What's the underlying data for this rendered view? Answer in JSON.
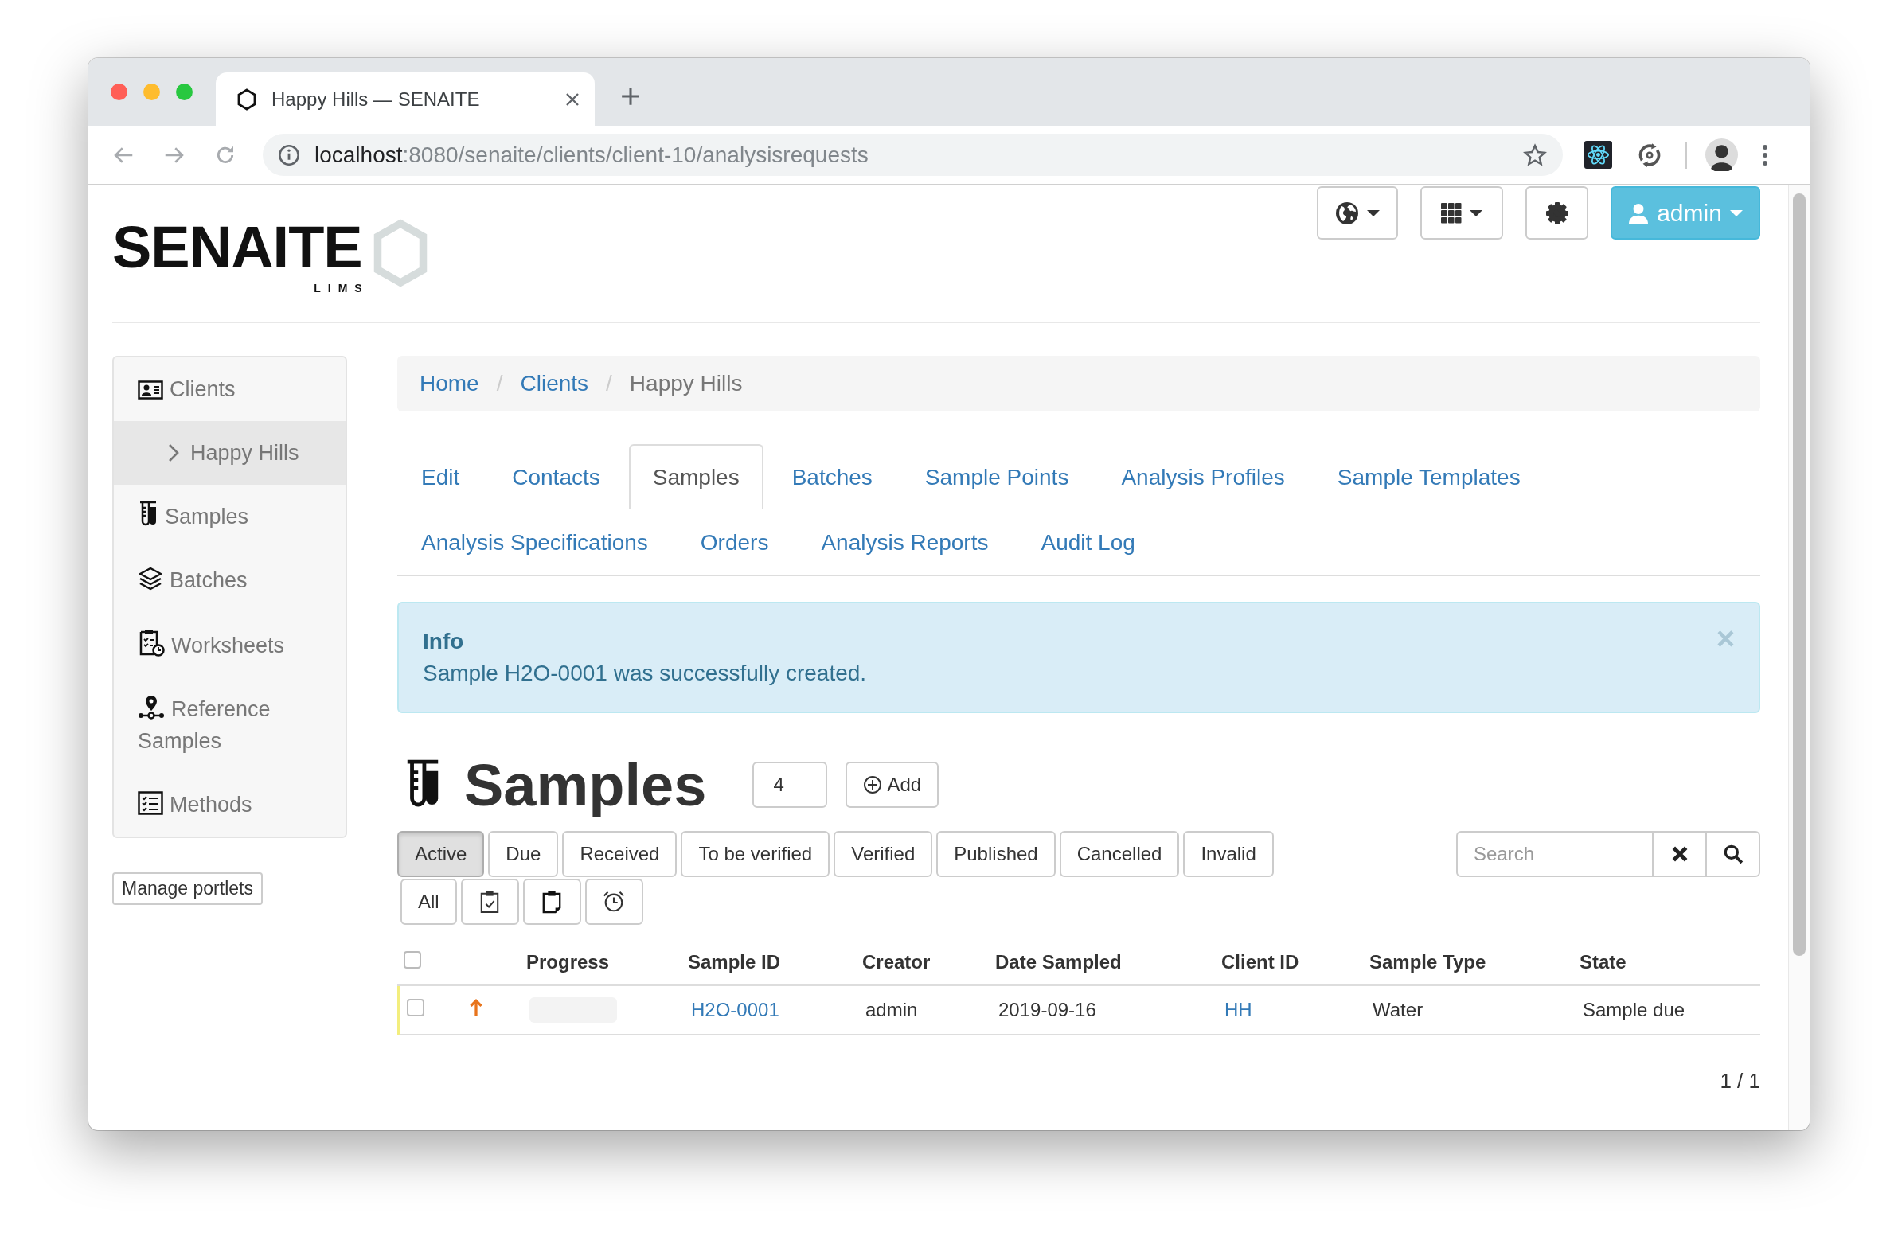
{
  "browser": {
    "tab_title": "Happy Hills — SENAITE",
    "address": {
      "host": "localhost",
      "path": ":8080/senaite/clients/client-10/analysisrequests"
    }
  },
  "logo": {
    "name": "SENAITE",
    "tagline": "LIMS"
  },
  "top_nav": {
    "user": "admin"
  },
  "sidebar": {
    "items": [
      {
        "label": "Clients",
        "selected": false,
        "children": [
          {
            "label": "Happy Hills",
            "selected": true
          }
        ]
      },
      {
        "label": "Samples",
        "selected": false
      },
      {
        "label": "Batches",
        "selected": false
      },
      {
        "label": "Worksheets",
        "selected": false
      },
      {
        "label": "Reference Samples",
        "selected": false
      },
      {
        "label": "Methods",
        "selected": false
      }
    ],
    "manage_button": "Manage portlets"
  },
  "breadcrumb": {
    "items": [
      {
        "label": "Home",
        "kind": "link"
      },
      {
        "label": "Clients",
        "kind": "link"
      },
      {
        "label": "Happy Hills",
        "kind": "current"
      }
    ],
    "separators": [
      "/",
      "/"
    ]
  },
  "tabs": [
    {
      "label": "Edit",
      "selected": false
    },
    {
      "label": "Contacts",
      "selected": false
    },
    {
      "label": "Samples",
      "selected": true
    },
    {
      "label": "Batches",
      "selected": false
    },
    {
      "label": "Sample Points",
      "selected": false
    },
    {
      "label": "Analysis Profiles",
      "selected": false
    },
    {
      "label": "Sample Templates",
      "selected": false
    },
    {
      "label": "Analysis Specifications",
      "selected": false
    },
    {
      "label": "Orders",
      "selected": false
    },
    {
      "label": "Analysis Reports",
      "selected": false
    },
    {
      "label": "Audit Log",
      "selected": false
    }
  ],
  "alert": {
    "title": "Info",
    "message": "Sample H2O-0001 was successfully created.",
    "close": "×"
  },
  "listing": {
    "title": "Samples",
    "count": "4",
    "add_button": "Add",
    "filters": [
      {
        "kind": "text",
        "label": "Active",
        "selected": true
      },
      {
        "kind": "text",
        "label": "Due",
        "selected": false
      },
      {
        "kind": "text",
        "label": "Received",
        "selected": false
      },
      {
        "kind": "text",
        "label": "To be verified",
        "selected": false
      },
      {
        "kind": "text",
        "label": "Verified",
        "selected": false
      },
      {
        "kind": "text",
        "label": "Published",
        "selected": false
      },
      {
        "kind": "text",
        "label": "Cancelled",
        "selected": false
      },
      {
        "kind": "text",
        "label": "Invalid",
        "selected": false
      }
    ],
    "more_filters": [
      {
        "kind": "text",
        "label": "All",
        "selected": false
      },
      {
        "kind": "icon",
        "selected": false
      },
      {
        "kind": "icon",
        "selected": false
      },
      {
        "kind": "icon",
        "selected": false
      }
    ],
    "search": {
      "placeholder": "Search"
    }
  },
  "table": {
    "select_all": {
      "checked": false
    },
    "columns": [
      "Progress",
      "Sample ID",
      "Creator",
      "Date Sampled",
      "Client ID",
      "Sample Type",
      "State"
    ],
    "rows": [
      {
        "checked": false,
        "level": 0,
        "sample_id": "H2O-0001",
        "creator": "admin",
        "date_sampled": "2019-09-16",
        "client_id": "HH",
        "sample_type": "Water",
        "state": "Sample due"
      }
    ]
  },
  "pagination": "1 / 1"
}
